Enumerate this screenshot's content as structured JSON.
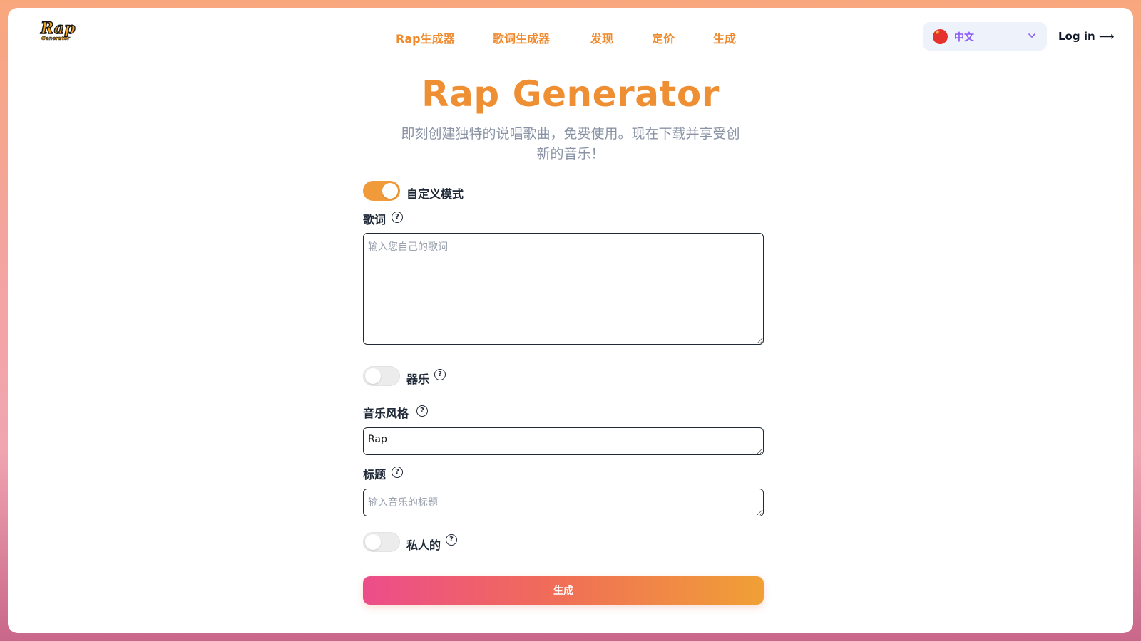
{
  "logo": {
    "text": "Rap",
    "subtext": "Generator"
  },
  "nav": {
    "items": [
      {
        "label": "Rap生成器"
      },
      {
        "label": "歌词生成器"
      },
      {
        "label": "发现"
      },
      {
        "label": "定价"
      },
      {
        "label": "生成"
      }
    ]
  },
  "language": {
    "label": "中文",
    "icon": "china-flag-icon"
  },
  "login": {
    "label": "Log in ⟶"
  },
  "hero": {
    "title": "Rap Generator",
    "subtitle": "即刻创建独特的说唱歌曲，免费使用。现在下载并享受创新的音乐！"
  },
  "form": {
    "custom_mode": {
      "label": "自定义模式",
      "enabled": true
    },
    "lyrics": {
      "label": "歌词",
      "placeholder": "输入您自己的歌词",
      "value": ""
    },
    "instrumental": {
      "label": "器乐",
      "enabled": false
    },
    "style": {
      "label": "音乐风格",
      "value": "Rap"
    },
    "title": {
      "label": "标题",
      "placeholder": "输入音乐的标题",
      "value": ""
    },
    "private": {
      "label": "私人的",
      "enabled": false
    },
    "help_icon": "?",
    "submit_label": "生成"
  },
  "colors": {
    "accent": "#ef8f34",
    "toggle_on": "#f19a3a",
    "button_start": "#ec4d8a",
    "button_end": "#f0a036"
  }
}
